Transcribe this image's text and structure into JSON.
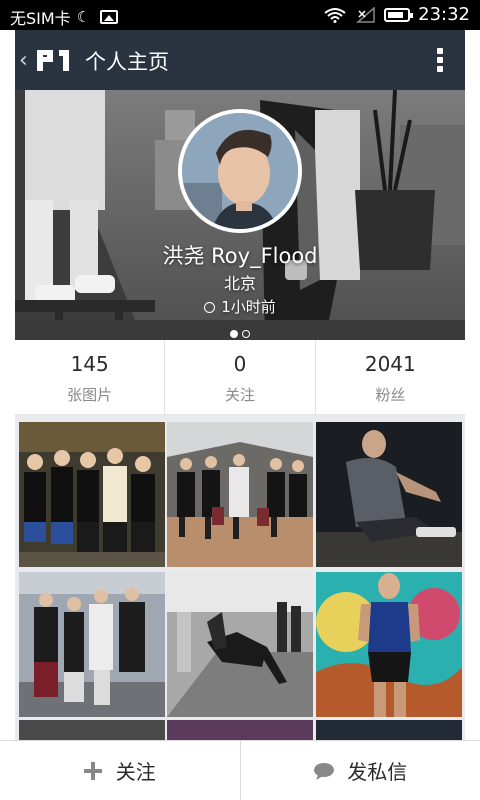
{
  "status_bar": {
    "carrier": "无SIM卡",
    "time": "23:32"
  },
  "header": {
    "logo_text": "P1",
    "title": "个人主页"
  },
  "profile": {
    "name": "洪尧 Roy_Flood",
    "city": "北京",
    "last_active": "1小时前",
    "carousel_pages": 2,
    "carousel_active": 1
  },
  "stats": [
    {
      "value": "145",
      "label": "张图片"
    },
    {
      "value": "0",
      "label": "关注"
    },
    {
      "value": "2041",
      "label": "粉丝"
    }
  ],
  "photos": [
    {
      "name": "photo-group-jerseys"
    },
    {
      "name": "photo-airport-group"
    },
    {
      "name": "photo-sitting-man"
    },
    {
      "name": "photo-group-station"
    },
    {
      "name": "photo-dance-street"
    },
    {
      "name": "photo-graffiti-wall"
    }
  ],
  "bottom_bar": {
    "follow_label": "关注",
    "message_label": "发私信"
  },
  "colors": {
    "header_bg": "#2a3340",
    "status_bg": "#000000"
  }
}
